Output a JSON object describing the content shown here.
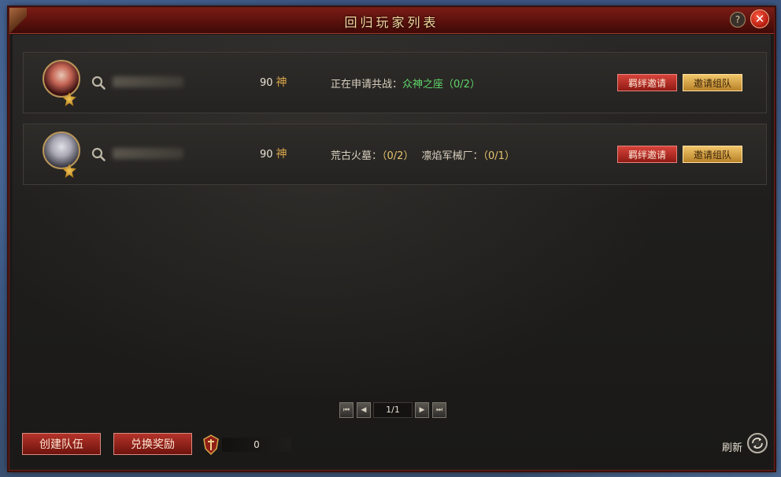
{
  "window": {
    "title": "回归玩家列表",
    "help_label": "?",
    "close_label": "✕"
  },
  "players": [
    {
      "level": "90",
      "god_label": "神",
      "status_prefix": "正在申请共战：",
      "status_target": "众神之座",
      "status_count": "（0/2）",
      "bond_label": "羁绊邀请",
      "team_label": "邀请组队"
    },
    {
      "level": "90",
      "god_label": "神",
      "dungeon1_name": "荒古火墓：",
      "dungeon1_count": "（0/2）",
      "dungeon2_name": "凛焰军械厂：",
      "dungeon2_count": "（0/1）",
      "bond_label": "羁绊邀请",
      "team_label": "邀请组队"
    }
  ],
  "pager": {
    "first": "⏮",
    "prev": "◀",
    "display": "1/1",
    "next": "▶",
    "last": "⏭"
  },
  "footer": {
    "create_team_label": "创建队伍",
    "exchange_reward_label": "兑换奖励",
    "points_value": "0",
    "refresh_label": "刷新"
  },
  "colors": {
    "title_bar": "#5a110d",
    "status_green": "#5fd66a",
    "count_gold": "#e6c36e",
    "btn_red": "#b4342b",
    "btn_gold": "#d8a64a"
  }
}
